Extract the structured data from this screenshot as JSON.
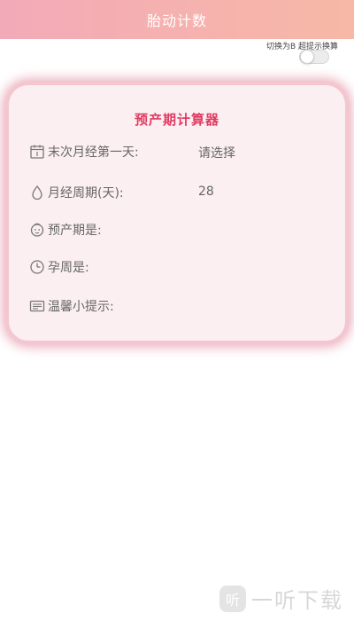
{
  "header": {
    "title": "胎动计数"
  },
  "switch": {
    "label": "切换为B 超提示换算",
    "state": "off"
  },
  "card": {
    "title": "预产期计算器",
    "rows": [
      {
        "icon": "calendar-icon",
        "label": "末次月经第一天:",
        "value": "请选择"
      },
      {
        "icon": "drop-icon",
        "label": "月经周期(天):",
        "value": "28"
      },
      {
        "icon": "baby-face-icon",
        "label": "预产期是:",
        "value": ""
      },
      {
        "icon": "clock-icon",
        "label": "孕周是:",
        "value": ""
      },
      {
        "icon": "note-icon",
        "label": "温馨小提示:",
        "value": ""
      }
    ]
  },
  "watermark": {
    "text": "一听下载",
    "logo": "听"
  },
  "colors": {
    "header_start": "#f3aab8",
    "header_end": "#f7b8a6",
    "card_bg": "#fbeff1",
    "card_border": "#e7a1b2",
    "title_color": "#e03a62"
  }
}
